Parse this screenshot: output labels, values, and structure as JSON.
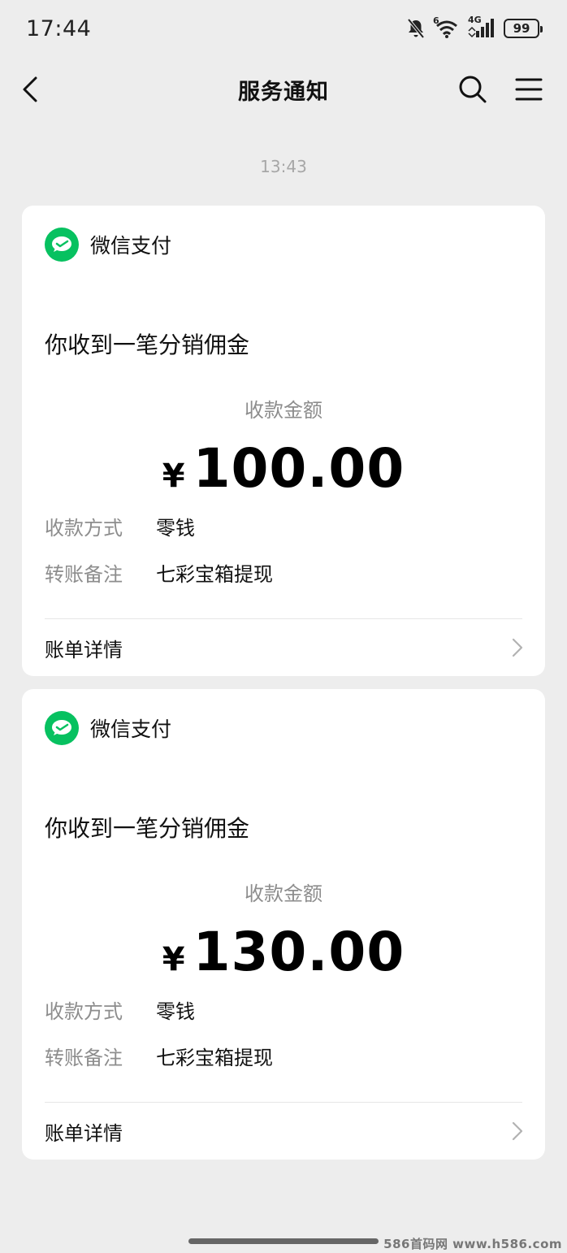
{
  "status_bar": {
    "time": "17:44",
    "battery": "99",
    "icons": [
      "bell-muted-icon",
      "wifi-icon",
      "signal-icon",
      "battery-icon"
    ],
    "wifi_badge": "6",
    "network": "4G"
  },
  "nav": {
    "title": "服务通知",
    "back_icon": "chevron-left-icon",
    "search_icon": "search-icon",
    "menu_icon": "menu-icon"
  },
  "timestamp": "13:43",
  "messages": [
    {
      "app_name": "微信支付",
      "title": "你收到一笔分销佣金",
      "amount_label": "收款金额",
      "currency": "¥",
      "amount": "100.00",
      "details": [
        {
          "key": "收款方式",
          "value": "零钱"
        },
        {
          "key": "转账备注",
          "value": "七彩宝箱提现"
        }
      ],
      "bill_label": "账单详情"
    },
    {
      "app_name": "微信支付",
      "title": "你收到一笔分销佣金",
      "amount_label": "收款金额",
      "currency": "¥",
      "amount": "130.00",
      "details": [
        {
          "key": "收款方式",
          "value": "零钱"
        },
        {
          "key": "转账备注",
          "value": "七彩宝箱提现"
        }
      ],
      "bill_label": "账单详情"
    }
  ],
  "watermark": "586首码网 www.h586.com",
  "colors": {
    "background": "#ededed",
    "card": "#ffffff",
    "wechat_green": "#07c160",
    "muted_text": "#8d8d8d"
  }
}
